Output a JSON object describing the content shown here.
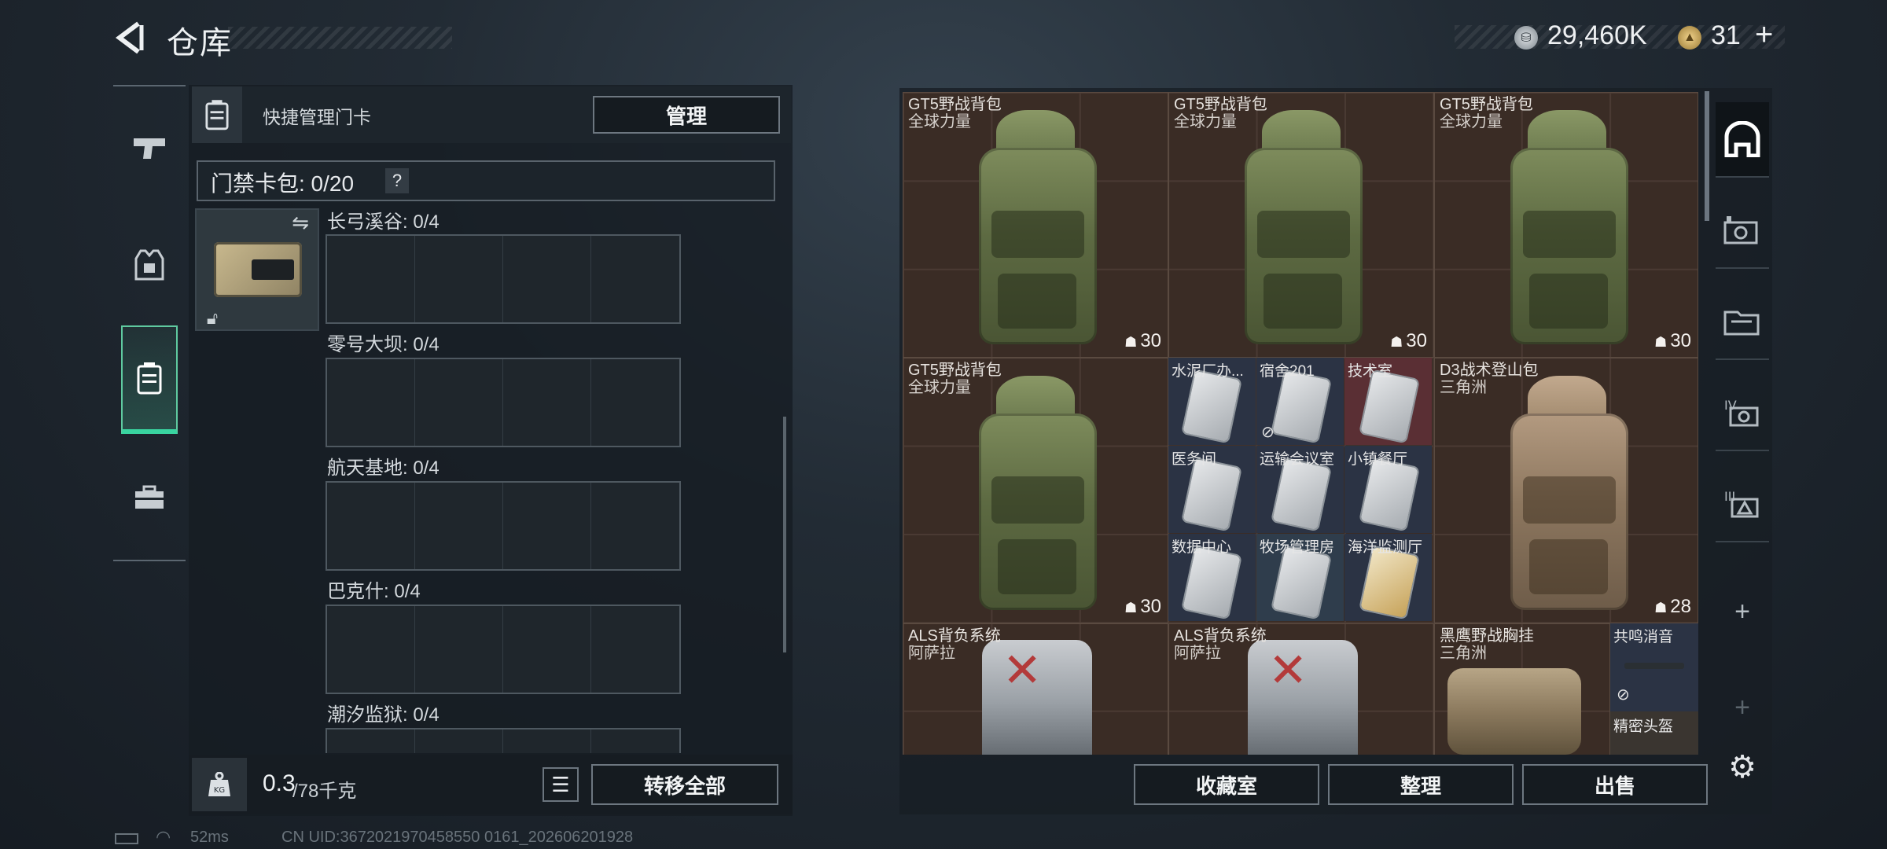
{
  "header": {
    "title": "仓库",
    "currency1_value": "29,460K",
    "currency2_value": "31"
  },
  "icons": {
    "back": "back-arrow-icon",
    "currency1": "silver-coin-icon",
    "currency2": "gold-coin-icon",
    "plus": "plus-icon"
  },
  "category_tabs": [
    {
      "name": "pistol-icon"
    },
    {
      "name": "armor-vest-icon"
    },
    {
      "name": "keycard-case-icon",
      "active": true
    },
    {
      "name": "toolbox-icon"
    }
  ],
  "left_panel": {
    "quick_manage_label": "快捷管理门卡",
    "manage_button": "管理",
    "card_bag_label": "门禁卡包: 0/20",
    "help": "?",
    "zones": [
      {
        "label": "长弓溪谷: 0/4"
      },
      {
        "label": "零号大坝: 0/4"
      },
      {
        "label": "航天基地: 0/4"
      },
      {
        "label": "巴克什: 0/4"
      },
      {
        "label": "潮汐监狱: 0/4"
      }
    ],
    "weight_value": "0.3",
    "weight_max": "/78千克",
    "weight_icon_text": "KG",
    "transfer_all_button": "转移全部"
  },
  "status_bar": {
    "ping": "52ms",
    "uid": "CN UID:3672021970458550 0161_202606201928"
  },
  "inventory": {
    "backpacks": [
      {
        "name": "GT5野战背包",
        "sub": "全球力量",
        "count": "30"
      },
      {
        "name": "GT5野战背包",
        "sub": "全球力量",
        "count": "30"
      },
      {
        "name": "GT5野战背包",
        "sub": "全球力量",
        "count": "30"
      },
      {
        "name": "GT5野战背包",
        "sub": "全球力量",
        "count": "30"
      },
      {
        "name": "D3战术登山包",
        "sub": "三角洲",
        "count": "28"
      }
    ],
    "cards": [
      {
        "label": "水泥厂办..."
      },
      {
        "label": "宿舍201"
      },
      {
        "label": "技术室"
      },
      {
        "label": "医务间"
      },
      {
        "label": "运输会议室"
      },
      {
        "label": "小镇餐厅"
      },
      {
        "label": "数据中心"
      },
      {
        "label": "牧场管理房"
      },
      {
        "label": "海洋监测厅"
      }
    ],
    "als": [
      {
        "name": "ALS背负系统",
        "sub": "阿萨拉"
      },
      {
        "name": "ALS背负系统",
        "sub": "阿萨拉"
      }
    ],
    "rig": {
      "name": "黑鹰野战胸挂",
      "sub": "三角洲"
    },
    "silencer": {
      "name": "共鸣消音"
    },
    "helmet": {
      "name": "精密头盔"
    },
    "buttons": {
      "collection": "收藏室",
      "organize": "整理",
      "sell": "出售"
    }
  },
  "right_tabs": [
    {
      "name": "storage-arch-icon",
      "active": true
    },
    {
      "name": "camera-case-icon"
    },
    {
      "name": "folder-tab-icon"
    },
    {
      "name": "rank-iv-icon"
    },
    {
      "name": "rank-iii-icon"
    }
  ],
  "colors": {
    "accent": "#39d4a0",
    "grid_bg": "#3a2c25",
    "card_red": "#5a2f34",
    "card_blue": "#2b3344"
  }
}
